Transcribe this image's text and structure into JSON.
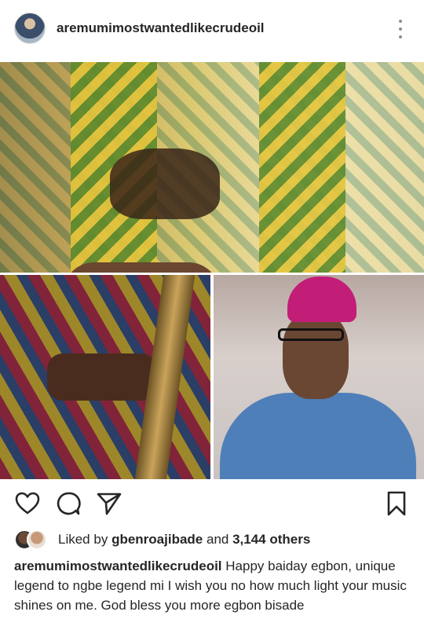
{
  "post": {
    "username": "aremumimostwantedlikecrudeoil",
    "more_icon": "more-vertical-icon"
  },
  "actions": {
    "like_icon": "heart-icon",
    "comment_icon": "comment-icon",
    "share_icon": "send-icon",
    "save_icon": "bookmark-icon"
  },
  "likes": {
    "prefix": "Liked by",
    "user": "gbenroajibade",
    "joiner": "and",
    "count": "3,144 others"
  },
  "caption": {
    "username": "aremumimostwantedlikecrudeoil",
    "text": "Happy baiday egbon, unique legend to ngbe legend mi I wish you no how much light your music shines on me. God bless you more egbon bisade"
  }
}
